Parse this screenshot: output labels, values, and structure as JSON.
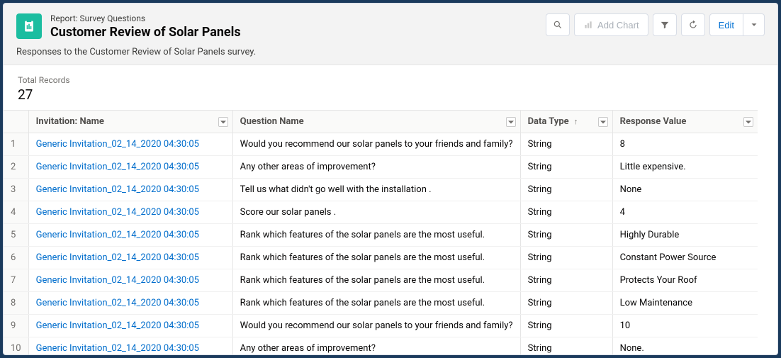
{
  "header": {
    "type_label": "Report: Survey Questions",
    "title": "Customer Review of Solar Panels",
    "description": "Responses to the Customer Review of Solar Panels survey."
  },
  "toolbar": {
    "add_chart": "Add Chart",
    "edit": "Edit"
  },
  "summary": {
    "total_records_label": "Total Records",
    "total_records_value": "27"
  },
  "columns": {
    "invitation": "Invitation: Name",
    "question": "Question Name",
    "datatype": "Data Type",
    "response": "Response Value"
  },
  "rows": [
    {
      "n": "1",
      "invitation": "Generic Invitation_02_14_2020 04:30:05",
      "question": "Would you recommend our solar panels to your friends and family?",
      "datatype": "String",
      "response": "8"
    },
    {
      "n": "2",
      "invitation": "Generic Invitation_02_14_2020 04:30:05",
      "question": "Any other areas of improvement?",
      "datatype": "String",
      "response": "Little expensive."
    },
    {
      "n": "3",
      "invitation": "Generic Invitation_02_14_2020 04:30:05",
      "question": "Tell us what didn't go well with the installation .",
      "datatype": "String",
      "response": "None"
    },
    {
      "n": "4",
      "invitation": "Generic Invitation_02_14_2020 04:30:05",
      "question": "Score our solar panels .",
      "datatype": "String",
      "response": "4"
    },
    {
      "n": "5",
      "invitation": "Generic Invitation_02_14_2020 04:30:05",
      "question": "Rank which features of the solar panels are the most useful.",
      "datatype": "String",
      "response": "Highly Durable"
    },
    {
      "n": "6",
      "invitation": "Generic Invitation_02_14_2020 04:30:05",
      "question": "Rank which features of the solar panels are the most useful.",
      "datatype": "String",
      "response": "Constant Power Source"
    },
    {
      "n": "7",
      "invitation": "Generic Invitation_02_14_2020 04:30:05",
      "question": "Rank which features of the solar panels are the most useful.",
      "datatype": "String",
      "response": "Protects Your Roof"
    },
    {
      "n": "8",
      "invitation": "Generic Invitation_02_14_2020 04:30:05",
      "question": "Rank which features of the solar panels are the most useful.",
      "datatype": "String",
      "response": "Low Maintenance"
    },
    {
      "n": "9",
      "invitation": "Generic Invitation_02_14_2020 04:30:05",
      "question": "Would you recommend our solar panels to your friends and family?",
      "datatype": "String",
      "response": "10"
    },
    {
      "n": "10",
      "invitation": "Generic Invitation_02_14_2020 04:30:05",
      "question": "Any other areas of improvement?",
      "datatype": "String",
      "response": "None."
    }
  ]
}
